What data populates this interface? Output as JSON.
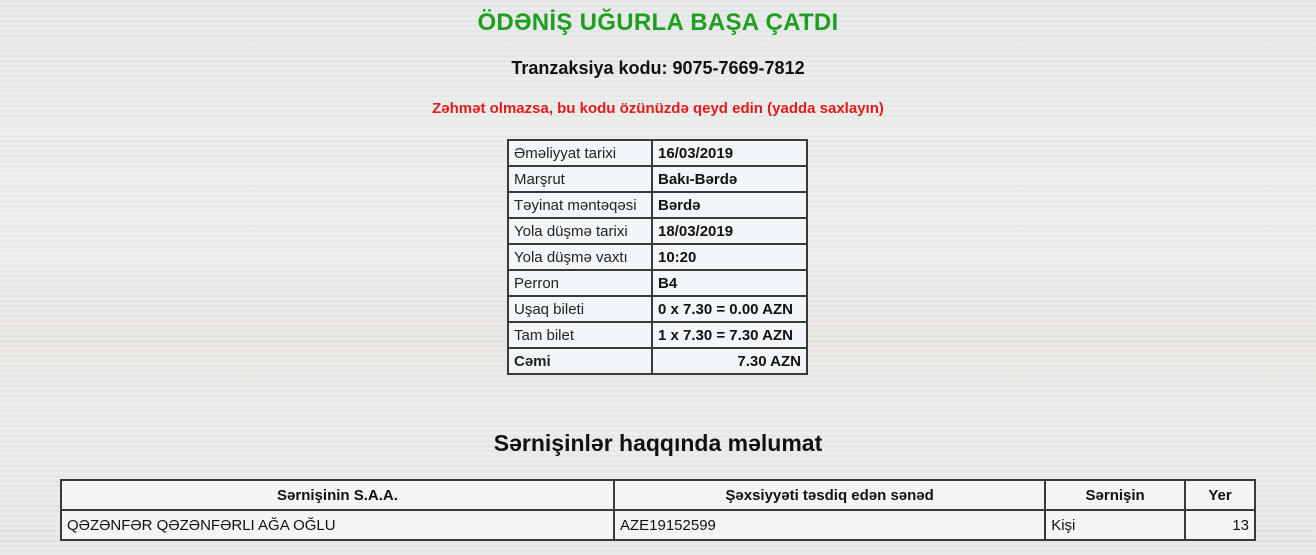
{
  "header": {
    "success_title": "ÖDƏNİŞ UĞURLA BAŞA ÇATDI",
    "transaction_label": "Tranzaksiya kodu:",
    "transaction_code": "9075-7669-7812",
    "warning": "Zəhmət olmazsa, bu kodu özünüzdə qeyd edin (yadda saxlayın)"
  },
  "details": [
    {
      "label": "Əməliyyat tarixi",
      "value": "16/03/2019"
    },
    {
      "label": "Marşrut",
      "value": "Bakı-Bərdə"
    },
    {
      "label": "Təyinat məntəqəsi",
      "value": "Bərdə"
    },
    {
      "label": "Yola düşmə tarixi",
      "value": "18/03/2019"
    },
    {
      "label": "Yola düşmə vaxtı",
      "value": "10:20"
    },
    {
      "label": "Perron",
      "value": "B4"
    },
    {
      "label": "Uşaq bileti",
      "value": "0 x 7.30 = 0.00 AZN"
    },
    {
      "label": "Tam bilet",
      "value": "1 x 7.30 = 7.30 AZN"
    },
    {
      "label": "Cəmi",
      "value": "7.30 AZN"
    }
  ],
  "passengers": {
    "title": "Sərnişinlər haqqında məlumat",
    "headers": [
      "Sərnişinin S.A.A.",
      "Şəxsiyyəti təsdiq edən sənəd",
      "Sərnişin",
      "Yer"
    ],
    "rows": [
      [
        "QƏZƏNFƏR QƏZƏNFƏRLI AĞA OĞLU",
        "AZE19152599",
        "Kişi",
        "13"
      ]
    ]
  },
  "colors": {
    "success": "#1ea01e",
    "warning": "#e41a1a"
  }
}
